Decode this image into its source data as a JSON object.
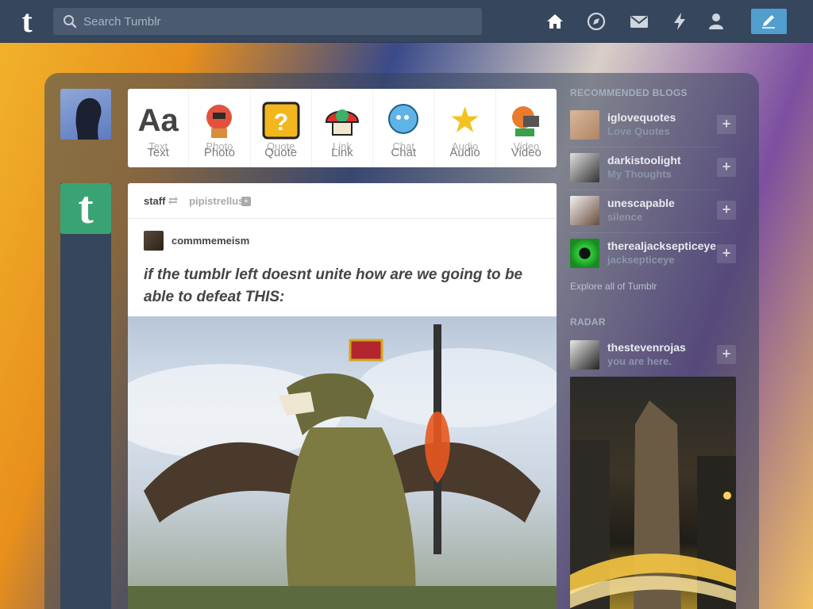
{
  "header": {
    "logo": "t",
    "search_placeholder": "Search Tumblr"
  },
  "postbar": {
    "items": [
      {
        "label": "Text",
        "ghost": "Text",
        "glyph": "Aa"
      },
      {
        "label": "Photo",
        "ghost": "Photo",
        "glyph": ""
      },
      {
        "label": "Quote",
        "ghost": "Quote",
        "glyph": "❝"
      },
      {
        "label": "Link",
        "ghost": "Link",
        "glyph": ""
      },
      {
        "label": "Chat",
        "ghost": "Chat",
        "glyph": ""
      },
      {
        "label": "Audio",
        "ghost": "Audio",
        "glyph": "★"
      },
      {
        "label": "Video",
        "ghost": "Video",
        "glyph": ""
      }
    ]
  },
  "dashboard": {
    "staff_avatar_letter": "t"
  },
  "post": {
    "author": "staff",
    "reblogged_from": "pipistrellus",
    "poster": "commmemeism",
    "title": "if the tumblr left doesnt unite how are we going to be able to defeat THIS:"
  },
  "sidebar": {
    "recommended_heading": "RECOMMENDED BLOGS",
    "blogs": [
      {
        "name": "iglovequotes",
        "subtitle": "Love Quotes"
      },
      {
        "name": "darkistoolight",
        "subtitle": "My Thoughts"
      },
      {
        "name": "unescapable",
        "subtitle": "silence"
      },
      {
        "name": "therealjacksepticeye",
        "subtitle": "jacksepticeye"
      }
    ],
    "explore_label": "Explore all of Tumblr",
    "radar_heading": "RADAR",
    "radar": {
      "name": "thestevenrojas",
      "subtitle": "you are here."
    }
  },
  "colors": {
    "header_bg": "#36465d",
    "accent": "#529ecc",
    "staff_green": "#3aa373"
  },
  "icons": [
    "search-icon",
    "home-icon",
    "explore-icon",
    "inbox-icon",
    "activity-icon",
    "account-icon",
    "compose-icon",
    "reblog-icon",
    "plus-icon"
  ]
}
